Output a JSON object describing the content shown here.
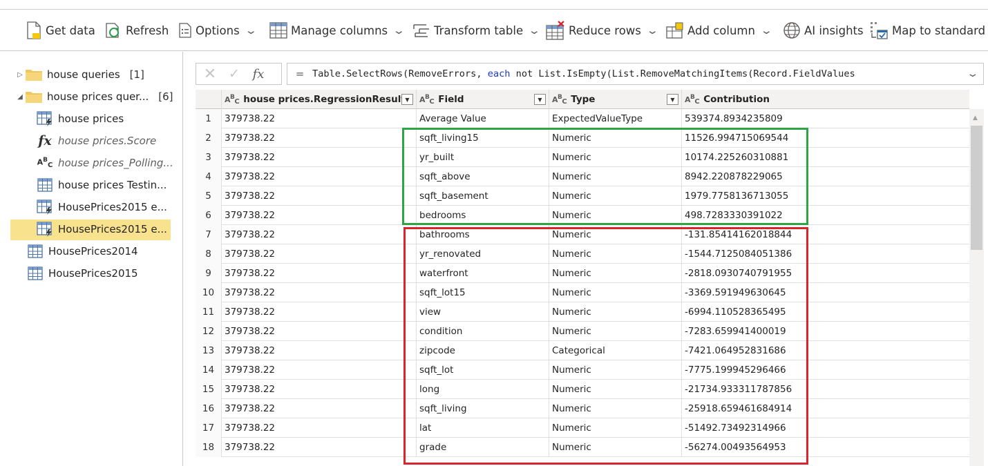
{
  "toolbar": {
    "get_data": "Get data",
    "refresh": "Refresh",
    "options": "Options",
    "manage_columns": "Manage columns",
    "transform_table": "Transform table",
    "reduce_rows": "Reduce rows",
    "add_column": "Add column",
    "ai_insights": "AI insights",
    "map_to_standard": "Map to standard"
  },
  "navigator": {
    "groups": [
      {
        "label": "house queries",
        "count": "[1]"
      },
      {
        "label": "house prices quer...",
        "count": "[6]"
      }
    ],
    "queries": [
      {
        "label": "house prices",
        "icon": "table-lightning-icon"
      },
      {
        "label": "house prices.Score",
        "icon": "fx-icon"
      },
      {
        "label": "house prices_Polling...",
        "icon": "abc-icon"
      },
      {
        "label": "house prices Testin...",
        "icon": "table-icon"
      },
      {
        "label": "HousePrices2015 e...",
        "icon": "table-lightning-icon"
      },
      {
        "label": "HousePrices2015 e...",
        "icon": "table-lightning-icon"
      },
      {
        "label": "HousePrices2014",
        "icon": "table-icon"
      },
      {
        "label": "HousePrices2015",
        "icon": "table-icon"
      }
    ]
  },
  "formula": {
    "fx": "fx",
    "equals": "=",
    "pre": "Table.SelectRows(RemoveErrors, ",
    "keyword": "each",
    "post": " not List.IsEmpty(List.RemoveMatchingItems(Record.FieldValues"
  },
  "grid": {
    "columns": [
      "house prices.RegressionResult",
      "Field",
      "Type",
      "Contribution"
    ],
    "rows": [
      [
        "1",
        "379738.22",
        "Average Value",
        "ExpectedValueType",
        "539374.8934235809"
      ],
      [
        "2",
        "379738.22",
        "sqft_living15",
        "Numeric",
        "11526.994715069544"
      ],
      [
        "3",
        "379738.22",
        "yr_built",
        "Numeric",
        "10174.225260310881"
      ],
      [
        "4",
        "379738.22",
        "sqft_above",
        "Numeric",
        "8942.220878229065"
      ],
      [
        "5",
        "379738.22",
        "sqft_basement",
        "Numeric",
        "1979.7758136713055"
      ],
      [
        "6",
        "379738.22",
        "bedrooms",
        "Numeric",
        "498.7283330391022"
      ],
      [
        "7",
        "379738.22",
        "bathrooms",
        "Numeric",
        "-131.85414162018844"
      ],
      [
        "8",
        "379738.22",
        "yr_renovated",
        "Numeric",
        "-1544.7125084051386"
      ],
      [
        "9",
        "379738.22",
        "waterfront",
        "Numeric",
        "-2818.0930740791955"
      ],
      [
        "10",
        "379738.22",
        "sqft_lot15",
        "Numeric",
        "-3369.591949630645"
      ],
      [
        "11",
        "379738.22",
        "view",
        "Numeric",
        "-6994.110528365495"
      ],
      [
        "12",
        "379738.22",
        "condition",
        "Numeric",
        "-7283.659941400019"
      ],
      [
        "13",
        "379738.22",
        "zipcode",
        "Categorical",
        "-7421.064952831686"
      ],
      [
        "14",
        "379738.22",
        "sqft_lot",
        "Numeric",
        "-7775.199945296466"
      ],
      [
        "15",
        "379738.22",
        "long",
        "Numeric",
        "-21734.933311787856"
      ],
      [
        "16",
        "379738.22",
        "sqft_living",
        "Numeric",
        "-25918.659461684914"
      ],
      [
        "17",
        "379738.22",
        "lat",
        "Numeric",
        "-51492.73492314966"
      ],
      [
        "18",
        "379738.22",
        "grade",
        "Numeric",
        "-56274.00493564953"
      ]
    ]
  },
  "colors": {
    "positive_box": "#2ca645",
    "negative_box": "#d9232d",
    "selected_query": "#f9e28e"
  }
}
